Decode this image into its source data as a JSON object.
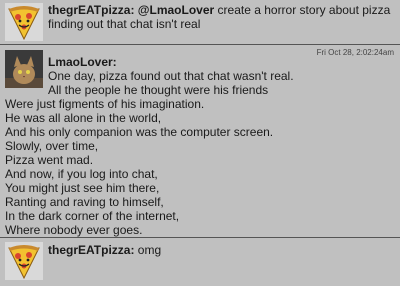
{
  "messages": [
    {
      "user": "thegrEATpizza:",
      "avatar_icon": "pizza-slice-avatar",
      "mention": "@LmaoLover",
      "text_rest": " create a horror story about pizza",
      "text_line2": "finding out that chat isn't real"
    },
    {
      "user": "LmaoLover:",
      "avatar_icon": "cat-avatar",
      "timestamp": "Fri Oct 28, 2:02:24am",
      "lines": [
        "One day, pizza found out that chat wasn't real.",
        "All the people he thought were his friends",
        "Were just figments of his imagination.",
        "He was all alone in the world,",
        "And his only companion was the computer screen.",
        "Slowly, over time,",
        "Pizza went mad.",
        "And now, if you log into chat,",
        "You might just see him there,",
        "Ranting and raving to himself,",
        "In the dark corner of the internet,",
        "Where nobody ever goes."
      ]
    },
    {
      "user": "thegrEATpizza:",
      "avatar_icon": "pizza-slice-avatar",
      "text": " omg"
    }
  ]
}
